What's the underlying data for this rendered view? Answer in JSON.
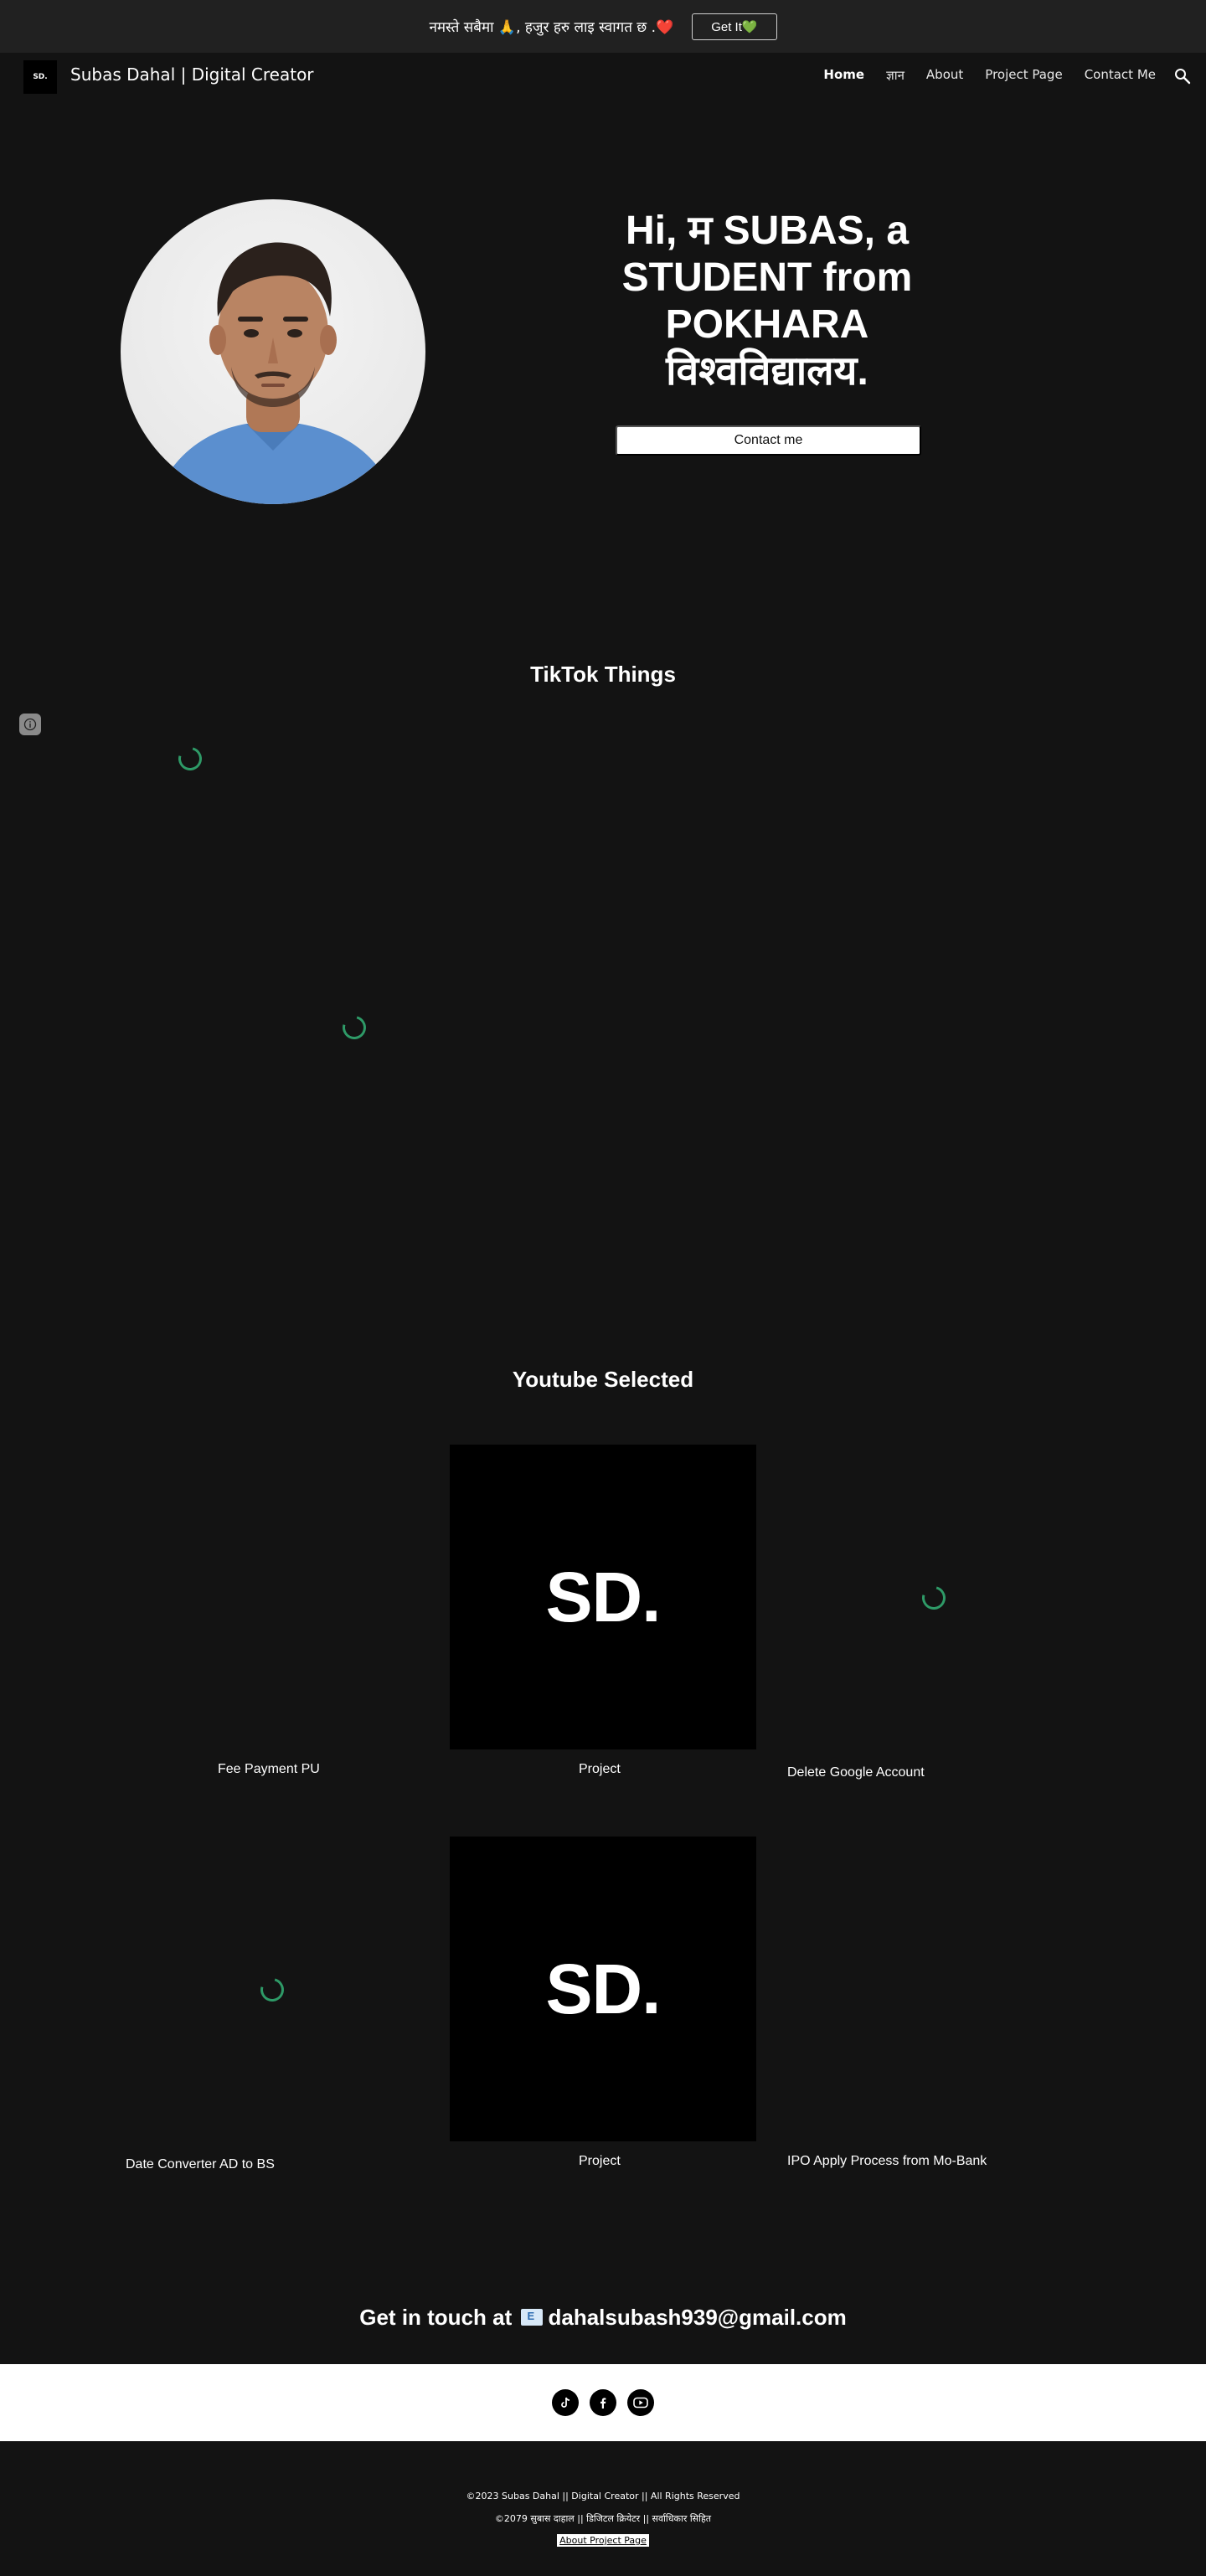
{
  "banner": {
    "text": "नमस्ते सबैमा 🙏, हजुर हरु लाइ स्वागत छ .❤️",
    "button": "Get It💚"
  },
  "header": {
    "logo_text": "SD.",
    "title": "Subas Dahal | Digital Creator",
    "nav": [
      "Home",
      "ज्ञान",
      "About",
      "Project Page",
      "Contact Me"
    ],
    "active_index": 0
  },
  "hero": {
    "line1": "Hi, म  SUBAS, a",
    "line2": "STUDENT from",
    "line3": "POKHARA",
    "line4": "विश्वविद्यालय.",
    "contact_button": "Contact me"
  },
  "tiktok": {
    "title": "TikTok Things"
  },
  "youtube": {
    "title": "Youtube Selected",
    "card_text": "SD.",
    "captions": [
      "Fee Payment PU",
      "Project",
      "Delete Google Account",
      "Date Converter AD to BS",
      "Project",
      "IPO Apply Process from Mo-Bank"
    ]
  },
  "contact": {
    "prefix": "Get in touch at",
    "email": "dahalsubash939@gmail.com"
  },
  "social": {
    "icons": [
      "tiktok-icon",
      "facebook-icon",
      "youtube-icon"
    ]
  },
  "footer": {
    "line1": "©2023 Subas Dahal || Digital  Creator || All Rights Reserved",
    "line2": "©2079 सुबास दाहाल || डिजिटल क्रियेटर || सर्वाधिकार सिहित",
    "link": "About Project Page"
  },
  "colors": {
    "background": "#131313",
    "banner": "#212121",
    "spinner": "#2e9a67"
  }
}
